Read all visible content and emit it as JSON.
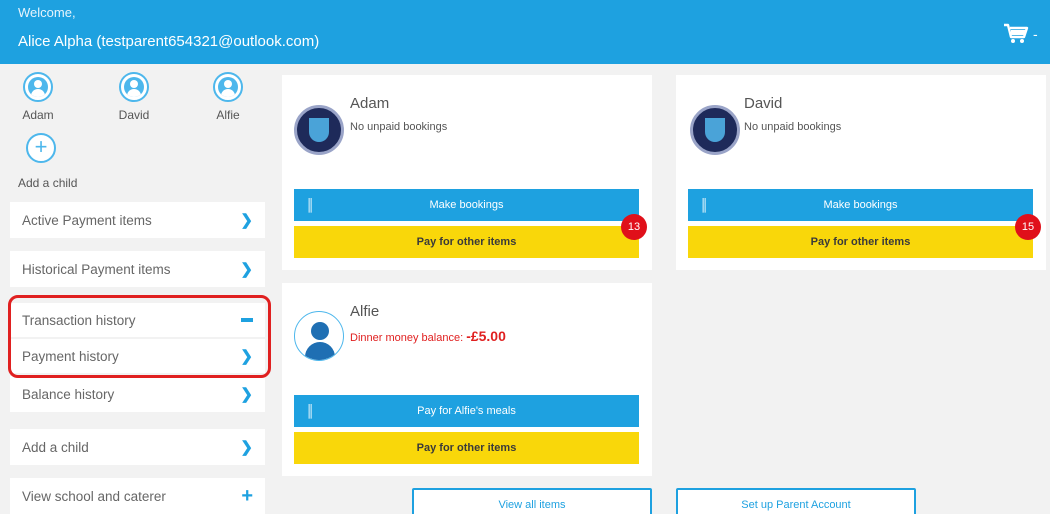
{
  "header": {
    "welcome": "Welcome,",
    "user": "Alice Alpha (testparent654321@outlook.com)",
    "cart_icon": "cart-icon",
    "cart_caret": "-"
  },
  "sidebar": {
    "children": [
      {
        "name": "Adam"
      },
      {
        "name": "David"
      },
      {
        "name": "Alfie"
      }
    ],
    "add_child_label": "Add a child",
    "menu": [
      {
        "label": "Active Payment items",
        "icon": "chevron-right"
      },
      {
        "label": "Historical Payment items",
        "icon": "chevron-right"
      },
      {
        "label": "Transaction history",
        "icon": "minus"
      },
      {
        "label": "Payment history",
        "icon": "chevron-right"
      },
      {
        "label": "Balance history",
        "icon": "chevron-right"
      },
      {
        "label": "Add a child",
        "icon": "chevron-right"
      },
      {
        "label": "View school and caterer",
        "icon": "plus"
      }
    ]
  },
  "cards": {
    "adam": {
      "name": "Adam",
      "status": "No unpaid bookings",
      "make_bookings": "Make bookings",
      "pay_other": "Pay for other items",
      "badge_count": "13"
    },
    "david": {
      "name": "David",
      "status": "No unpaid bookings",
      "make_bookings": "Make bookings",
      "pay_other": "Pay for other items",
      "badge_count": "15"
    },
    "alfie": {
      "name": "Alfie",
      "balance_label": "Dinner money balance:",
      "balance_value": "-£5.00",
      "pay_meals": "Pay for Alfie's meals",
      "pay_other": "Pay for other items"
    }
  },
  "footer_buttons": {
    "view_all": "View all items",
    "setup_account": "Set up Parent Account"
  },
  "colors": {
    "primary_blue": "#1ea1e0",
    "yellow": "#f9d70a",
    "red": "#e0101a"
  }
}
